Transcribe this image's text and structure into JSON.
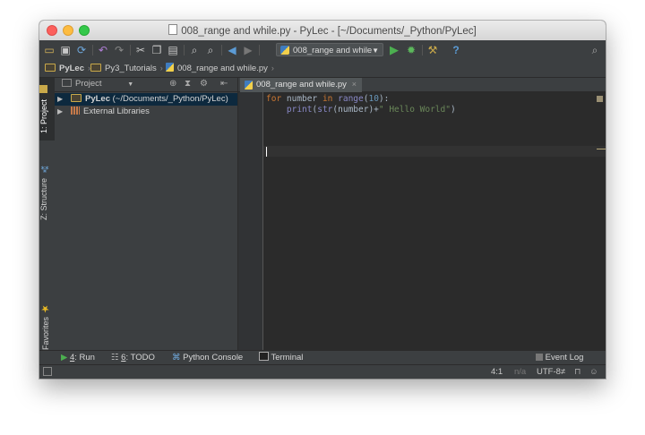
{
  "window": {
    "title": "008_range and while.py - PyLec - [~/Documents/_Python/PyLec]"
  },
  "toolbar": {
    "run_config": "008_range and while",
    "icons": [
      "open-folder-icon",
      "save-icon",
      "sync-icon",
      "undo-icon",
      "redo-icon",
      "cut-icon",
      "copy-icon",
      "paste-icon",
      "find-icon",
      "replace-icon",
      "back-icon",
      "forward-icon",
      "run-icon",
      "debug-icon",
      "vcs-icon",
      "help-icon",
      "search-everywhere-icon"
    ]
  },
  "breadcrumb": {
    "items": [
      "PyLec",
      "Py3_Tutorials",
      "008_range and while.py"
    ]
  },
  "left_tool_tabs": {
    "project": "1: Project",
    "structure": "Z: Structure",
    "favorites": "2: Favorites"
  },
  "project_panel": {
    "view_label": "Project",
    "tree": [
      {
        "bold": "PyLec",
        "rest": " (~/Documents/_Python/PyLec)",
        "selected": true
      },
      {
        "label": "External Libraries",
        "selected": false
      }
    ]
  },
  "editor": {
    "tab_label": "008_range and while.py",
    "code": {
      "line1": {
        "kw": "for",
        "a": " number ",
        "kw2": "in",
        "sp": " ",
        "fn": "range",
        "p1": "(",
        "num": "10",
        "p2": "):"
      },
      "line2": {
        "indent": "    ",
        "fn": "print",
        "p1": "(",
        "fn2": "str",
        "p2": "(number)+",
        "str": "\" Hello World\"",
        "p3": ")"
      }
    }
  },
  "bottom_tools": {
    "run": {
      "num": "4",
      "label": ": Run"
    },
    "todo": {
      "num": "6",
      "label": ": TODO"
    },
    "console": "Python Console",
    "terminal": "Terminal",
    "event_log": "Event Log"
  },
  "status": {
    "position": "4:1",
    "na": "n/a",
    "encoding": "UTF-8≠"
  },
  "colors": {
    "editor_bg": "#2b2b2b",
    "panel_bg": "#3c3f41",
    "keyword": "#cc7832",
    "string": "#6a8759",
    "number": "#6897bb",
    "builtin": "#8888c6"
  }
}
